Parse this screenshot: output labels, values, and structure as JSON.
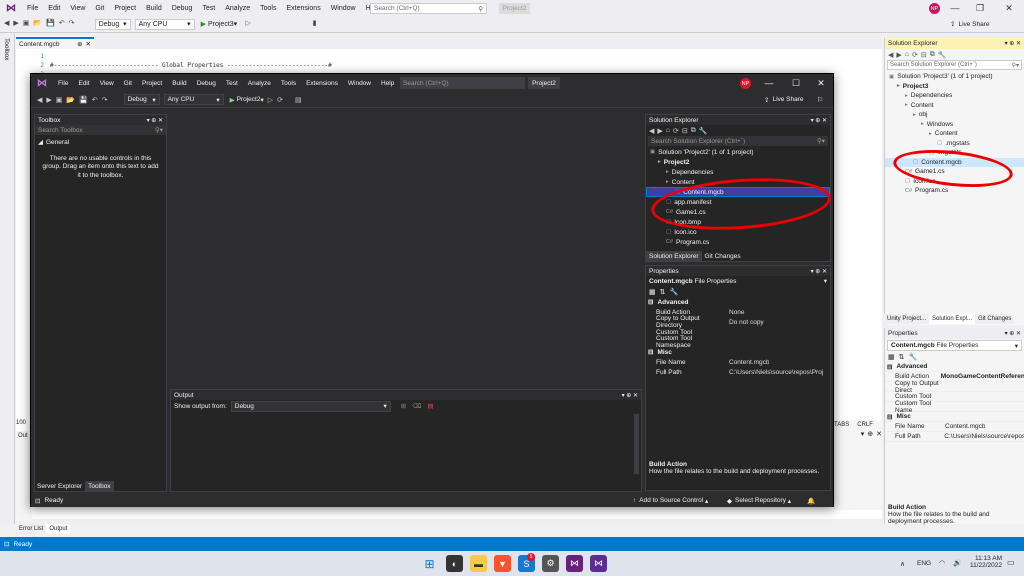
{
  "outer": {
    "menu": [
      "File",
      "Edit",
      "View",
      "Git",
      "Project",
      "Build",
      "Debug",
      "Test",
      "Analyze",
      "Tools",
      "Extensions",
      "Window",
      "Help"
    ],
    "search_placeholder": "Search (Ctrl+Q)",
    "title_badge": "Project2",
    "avatar": "NP",
    "toolbar": {
      "config": "Debug",
      "platform": "Any CPU",
      "run": "Project3"
    },
    "live_share": "Live Share",
    "left_strip": "Toolbox",
    "doc_tab": "Content.mgcb",
    "code_lines": [
      {
        "num": "1",
        "text": ""
      },
      {
        "num": "2",
        "text": "#----------------------------- Global Properties ----------------------------#"
      },
      {
        "num": "3",
        "text": ""
      }
    ],
    "solution_explorer": {
      "title": "Solution Explorer",
      "search": "Search Solution Explorer (Ctrl+`)",
      "items": [
        {
          "label": "Solution 'Project3' (1 of 1 project)",
          "indent": 0
        },
        {
          "label": "Project3",
          "indent": 1,
          "bold": true
        },
        {
          "label": "Dependencies",
          "indent": 2
        },
        {
          "label": "Content",
          "indent": 2
        },
        {
          "label": "obj",
          "indent": 3
        },
        {
          "label": "Windows",
          "indent": 4
        },
        {
          "label": "Content",
          "indent": 5
        },
        {
          "label": ".mgstats",
          "indent": 6
        },
        {
          "label": ".mgstats",
          "indent": 5
        },
        {
          "label": "Content.mgcb",
          "indent": 3,
          "selected": true
        },
        {
          "label": "Game1.cs",
          "indent": 2
        },
        {
          "label": "Icon.ico",
          "indent": 2
        },
        {
          "label": "Program.cs",
          "indent": 2
        }
      ],
      "bottom_tabs": [
        "Unity Project...",
        "Solution Expl...",
        "Git Changes"
      ]
    },
    "properties": {
      "title": "Properties",
      "object": "Content.mgcb",
      "object_type": "File Properties",
      "sections": [
        {
          "name": "Advanced",
          "rows": [
            {
              "k": "Build Action",
              "v": "MonoGameContentReference"
            },
            {
              "k": "Copy to Output Direct",
              "v": ""
            },
            {
              "k": "Custom Tool",
              "v": ""
            },
            {
              "k": "Custom Tool Name",
              "v": ""
            }
          ]
        },
        {
          "name": "Misc",
          "rows": [
            {
              "k": "File Name",
              "v": "Content.mgcb"
            },
            {
              "k": "Full Path",
              "v": "C:\\Users\\Niels\\source\\repos"
            }
          ]
        }
      ],
      "desc_title": "Build Action",
      "desc_text": "How the file relates to the build and deployment processes."
    },
    "bottom_tabs": [
      "Error List",
      "Output"
    ],
    "status": "Ready",
    "right_strip_labels": [
      "TABS",
      "CRLF"
    ],
    "zoom_label": "100",
    "output_title": "Out"
  },
  "inner": {
    "menu": [
      "File",
      "Edit",
      "View",
      "Git",
      "Project",
      "Build",
      "Debug",
      "Test",
      "Analyze",
      "Tools",
      "Extensions",
      "Window",
      "Help"
    ],
    "search_placeholder": "Search (Ctrl+Q)",
    "title_badge": "Project2",
    "avatar": "NP",
    "toolbar": {
      "config": "Debug",
      "platform": "Any CPU",
      "run": "Project2"
    },
    "live_share": "Live Share",
    "toolbox": {
      "title": "Toolbox",
      "search": "Search Toolbox",
      "group": "General",
      "empty_msg": "There are no usable controls in this group. Drag an item onto this text to add it to the toolbox."
    },
    "solution_explorer": {
      "title": "Solution Explorer",
      "search": "Search Solution Explorer (Ctrl+`)",
      "items": [
        {
          "label": "Solution 'Project2' (1 of 1 project)",
          "indent": 0
        },
        {
          "label": "Project2",
          "indent": 1,
          "bold": true
        },
        {
          "label": "Dependencies",
          "indent": 2
        },
        {
          "label": "Content",
          "indent": 2
        },
        {
          "label": "Content.mgcb",
          "indent": 3,
          "selected": true
        },
        {
          "label": "app.manifest",
          "indent": 2
        },
        {
          "label": "Game1.cs",
          "indent": 2
        },
        {
          "label": "Icon.bmp",
          "indent": 2
        },
        {
          "label": "Icon.ico",
          "indent": 2
        },
        {
          "label": "Program.cs",
          "indent": 2
        }
      ],
      "bottom_tabs": [
        "Solution Explorer",
        "Git Changes"
      ]
    },
    "properties": {
      "title": "Properties",
      "object": "Content.mgcb",
      "object_type": "File Properties",
      "sections": [
        {
          "name": "Advanced",
          "rows": [
            {
              "k": "Build Action",
              "v": "None"
            },
            {
              "k": "Copy to Output Directory",
              "v": "Do not copy"
            },
            {
              "k": "Custom Tool",
              "v": ""
            },
            {
              "k": "Custom Tool Namespace",
              "v": ""
            }
          ]
        },
        {
          "name": "Misc",
          "rows": [
            {
              "k": "File Name",
              "v": "Content.mgcb"
            },
            {
              "k": "Full Path",
              "v": "C:\\Users\\Niels\\source\\repos\\Proj"
            }
          ]
        }
      ],
      "desc_title": "Build Action",
      "desc_text": "How the file relates to the build and deployment processes."
    },
    "output": {
      "title": "Output",
      "show_from_label": "Show output from:",
      "show_from_value": "Debug"
    },
    "bottom_tabs": [
      "Server Explorer",
      "Toolbox"
    ],
    "status": "Ready",
    "add_source_control": "Add to Source Control",
    "select_repo": "Select Repository"
  },
  "taskbar": {
    "lang": "ENG",
    "time": "11:13 AM",
    "date": "11/22/2022",
    "badge": "5"
  }
}
